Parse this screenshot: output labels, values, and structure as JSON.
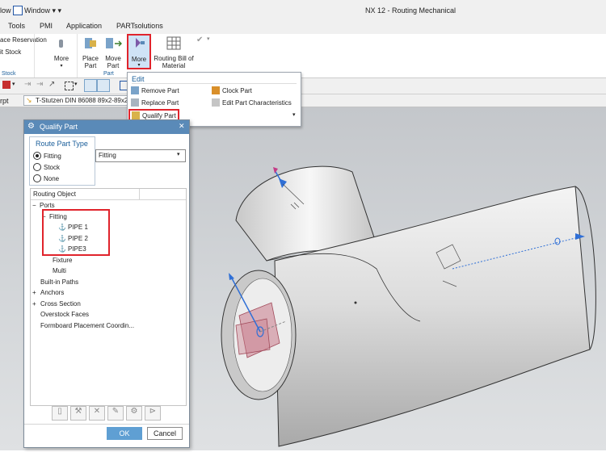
{
  "titlebar": {
    "left_fragment": "low",
    "window_menu": "Window ▾ ▾",
    "app_title": "NX 12 - Routing Mechanical"
  },
  "menubar": {
    "items": [
      "Tools",
      "PMI",
      "Application",
      "PARTsolutions"
    ]
  },
  "ribbon": {
    "left_items": [
      "ace Reservation",
      "it Stock"
    ],
    "stock_group": "Stock",
    "more1": "More",
    "place_part": "Place Part",
    "move_part": "Move Part",
    "more2": "More",
    "routing_bom": "Routing Bill of Material",
    "part_group": "Part"
  },
  "doc_tabs": {
    "left_fragment": "rpt",
    "active_tab": "T-Stutzen DIN 86088 89x2-89x2"
  },
  "dropdown": {
    "header": "Edit",
    "items_left": [
      "Remove Part",
      "Replace Part",
      "Qualify Part"
    ],
    "items_right": [
      "Clock Part",
      "Edit Part Characteristics"
    ]
  },
  "dialog": {
    "title": "Qualify Part",
    "route_part_type_label": "Route Part Type",
    "radios": [
      "Fitting",
      "Stock",
      "None"
    ],
    "selected_radio": "Fitting",
    "select_value": "Fitting",
    "tree_header": "Routing Object",
    "tree": {
      "ports": "Ports",
      "fitting": "Fitting",
      "pipes": [
        "PIPE 1",
        "PIPE 2",
        "PIPE3"
      ],
      "fixture": "Fixture",
      "multi": "Multi",
      "built_in_paths": "Built-in Paths",
      "anchors": "Anchors",
      "cross_section": "Cross Section",
      "overstock_faces": "Overstock Faces",
      "formboard": "Formboard Placement Coordin..."
    },
    "ok": "OK",
    "cancel": "Cancel"
  },
  "colors": {
    "accent": "#5a8ab8",
    "highlight": "#e0242c",
    "ok_button": "#5f9fd3"
  }
}
